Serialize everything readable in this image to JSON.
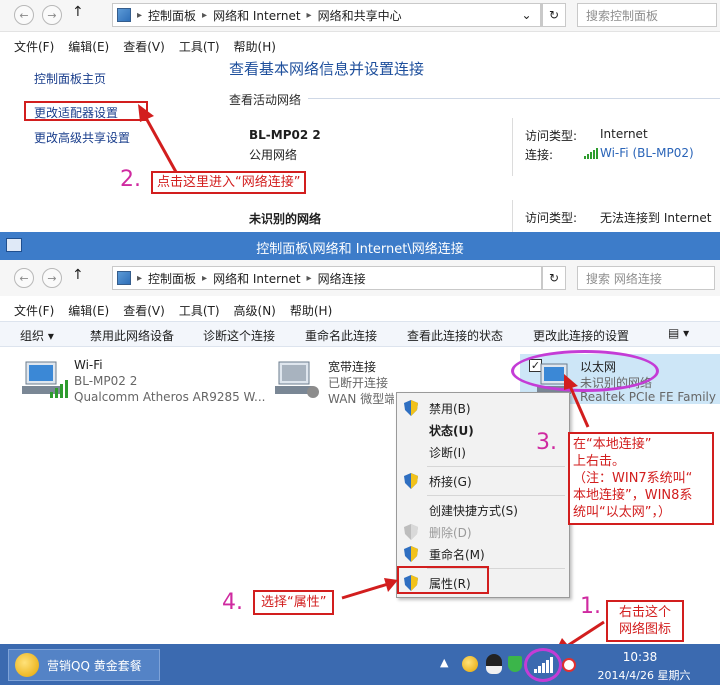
{
  "bg_window": {
    "address": [
      "控制面板",
      "网络和 Internet",
      "网络和共享中心"
    ],
    "search_placeholder": "搜索控制面板",
    "menu": [
      "文件(F)",
      "编辑(E)",
      "查看(V)",
      "工具(T)",
      "帮助(H)"
    ],
    "sidebar": [
      "控制面板主页",
      "更改适配器设置",
      "更改高级共享设置"
    ],
    "heading": "查看基本网络信息并设置连接",
    "active_label": "查看活动网络",
    "net1": {
      "name": "BL-MP02  2",
      "type": "公用网络",
      "access_label": "访问类型:",
      "access_value": "Internet",
      "conn_label": "连接:",
      "conn_value": "Wi-Fi (BL-MP02)"
    },
    "net2": {
      "name": "未识别的网络",
      "access_label": "访问类型:",
      "access_value": "无法连接到 Internet"
    }
  },
  "fg_window": {
    "title": "控制面板\\网络和 Internet\\网络连接",
    "address": [
      "控制面板",
      "网络和 Internet",
      "网络连接"
    ],
    "search_placeholder": "搜索 网络连接",
    "menu": [
      "文件(F)",
      "编辑(E)",
      "查看(V)",
      "工具(T)",
      "高级(N)",
      "帮助(H)"
    ],
    "toolbar": [
      "组织 ▾",
      "禁用此网络设备",
      "诊断这个连接",
      "重命名此连接",
      "查看此连接的状态",
      "更改此连接的设置"
    ],
    "adapters": [
      {
        "name": "Wi-Fi",
        "line2": "BL-MP02  2",
        "line3": "Qualcomm Atheros AR9285 W..."
      },
      {
        "name": "宽带连接",
        "line2": "已断开连接",
        "line3": "WAN 微型端"
      },
      {
        "name": "以太网",
        "line2": "未识别的网络",
        "line3": "Realtek PCIe FE Family"
      }
    ]
  },
  "context_menu": [
    "禁用(B)",
    "状态(U)",
    "诊断(I)",
    "桥接(G)",
    "创建快捷方式(S)",
    "删除(D)",
    "重命名(M)",
    "属性(R)"
  ],
  "annotations": {
    "step1_num": "1.",
    "step1_lines": [
      "右击这个",
      "网络图标"
    ],
    "step2_num": "2.",
    "step2_text": "点击这里进入“网络连接”",
    "step3_num": "3.",
    "step3_lines": [
      "在“本地连接”",
      "上右击。",
      "（注：WIN7系统叫“",
      "本地连接”，WIN8系",
      "统叫“以太网”，）"
    ],
    "step4_num": "4.",
    "step4_text": "选择“属性”"
  },
  "taskbar": {
    "app": "营销QQ 黄金套餐",
    "time": "10:38",
    "date": "2014/4/26 星期六"
  },
  "colors": {
    "annot_red": "#d21e1e",
    "step_num": "#cf2aa0",
    "ellipse": "#c43cd6",
    "window_frame": "#3d7cc9"
  }
}
